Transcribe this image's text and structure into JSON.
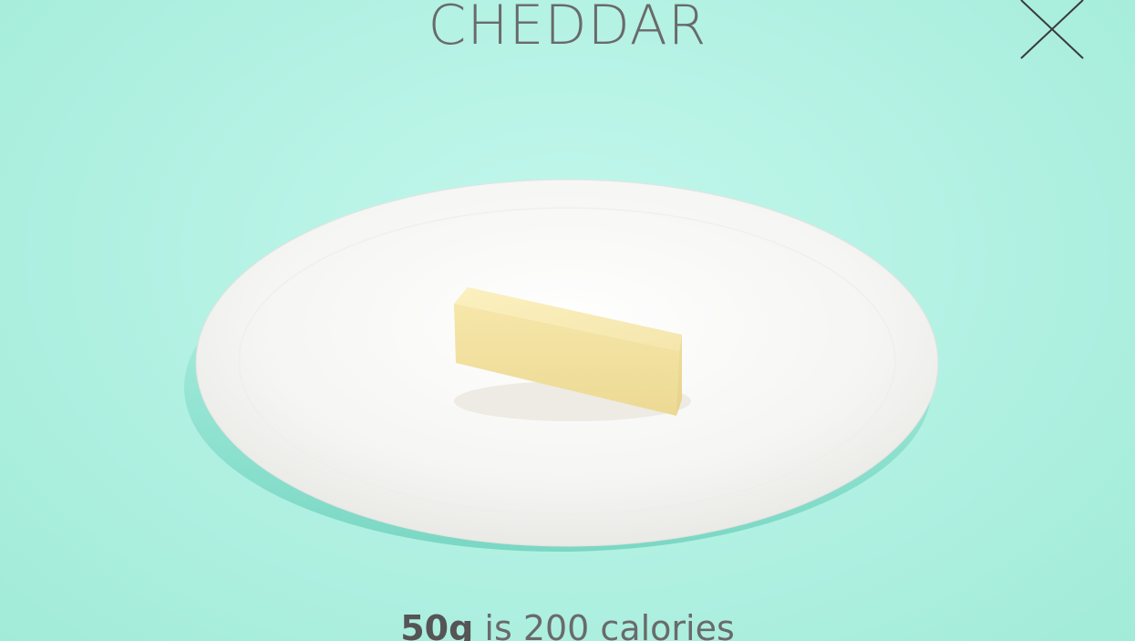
{
  "food": {
    "name": "CHEDDAR",
    "amount": "50g",
    "description": " is 200 calories"
  },
  "icons": {
    "close": "close-icon"
  },
  "colors": {
    "background": "#b4f2e4",
    "plate": "#f4f4f2",
    "cheese": "#f3e4a8",
    "text": "#6a6a6a"
  }
}
